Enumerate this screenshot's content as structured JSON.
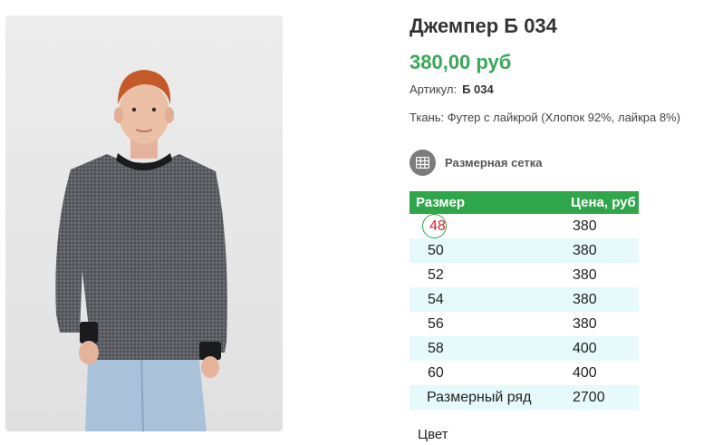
{
  "product": {
    "title": "Джемпер Б 034",
    "price": "380,00 руб",
    "sku_label": "Артикул:",
    "sku_value": "Б 034",
    "fabric": "Ткань: Футер с лайкрой (Хлопок 92%, лайкра 8%)",
    "size_chart_label": "Размерная сетка",
    "size_chart_icon": "table-grid-icon"
  },
  "price_table": {
    "headers": [
      "Размер",
      "Цена, руб"
    ],
    "rows": [
      {
        "size": "48",
        "price": "380",
        "selected": true
      },
      {
        "size": "50",
        "price": "380"
      },
      {
        "size": "52",
        "price": "380"
      },
      {
        "size": "54",
        "price": "380"
      },
      {
        "size": "56",
        "price": "380"
      },
      {
        "size": "58",
        "price": "400"
      },
      {
        "size": "60",
        "price": "400"
      },
      {
        "size": "Размерный ряд",
        "price": "2700"
      }
    ]
  },
  "color_label": "Цвет",
  "colors": {
    "accent_green": "#2fa64a",
    "price_green": "#3aa757",
    "selected_red": "#d8232a",
    "row_alt": "#e6f9fb"
  }
}
